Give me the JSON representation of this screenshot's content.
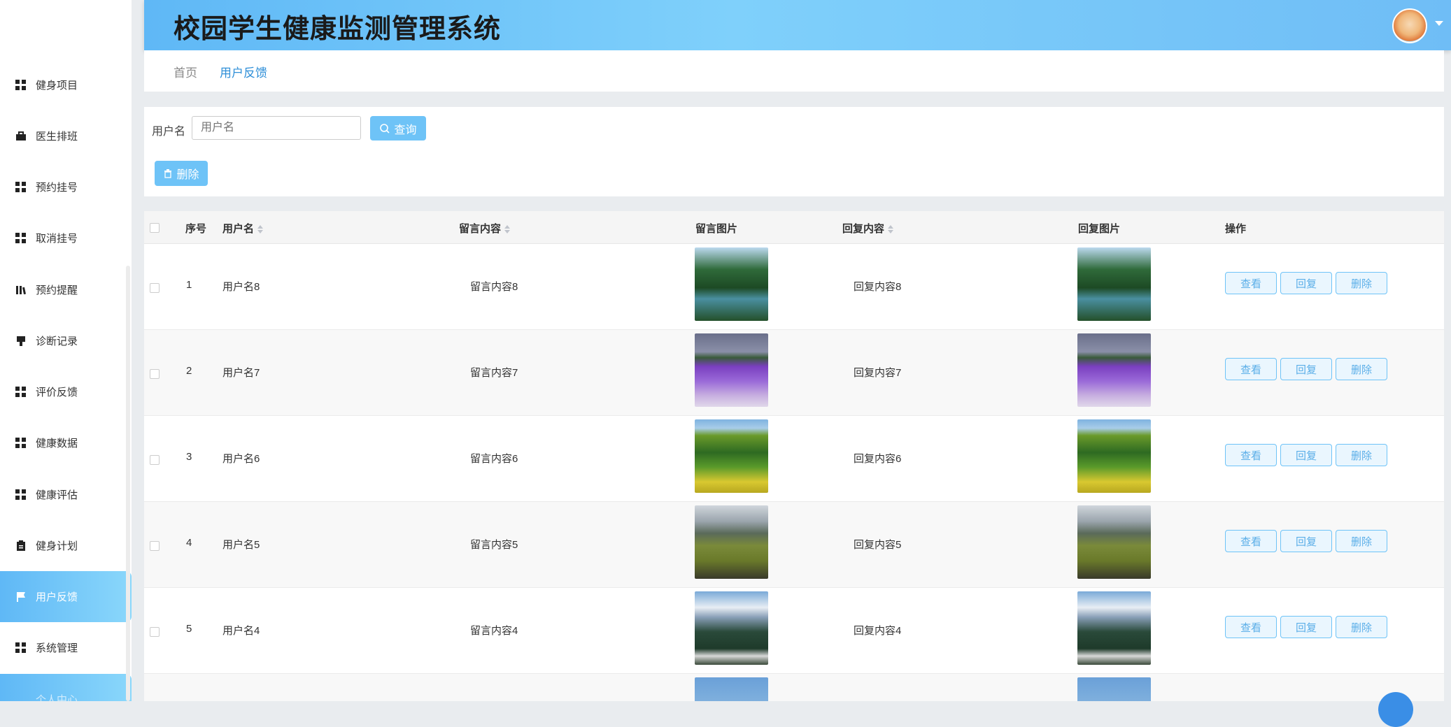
{
  "header": {
    "title": "校园学生健康监测管理系统"
  },
  "sidebar": {
    "items": [
      {
        "label": "健身项目",
        "icon": "grid-icon"
      },
      {
        "label": "医生排班",
        "icon": "briefcase-icon"
      },
      {
        "label": "预约挂号",
        "icon": "grid-icon"
      },
      {
        "label": "取消挂号",
        "icon": "grid-icon"
      },
      {
        "label": "预约提醒",
        "icon": "library-icon"
      },
      {
        "label": "诊断记录",
        "icon": "stamp-icon"
      },
      {
        "label": "评价反馈",
        "icon": "grid-icon"
      },
      {
        "label": "健康数据",
        "icon": "grid-icon"
      },
      {
        "label": "健康评估",
        "icon": "grid-icon"
      },
      {
        "label": "健身计划",
        "icon": "clipboard-icon"
      },
      {
        "label": "用户反馈",
        "icon": "flag-icon"
      },
      {
        "label": "系统管理",
        "icon": "grid-icon"
      },
      {
        "label": "个人中心",
        "icon": "user-icon"
      }
    ],
    "active_label": "用户反馈"
  },
  "breadcrumb": {
    "home": "首页",
    "current": "用户反馈"
  },
  "search": {
    "label": "用户名",
    "placeholder": "用户名",
    "query_button": "查询",
    "delete_button": "删除"
  },
  "table": {
    "headers": {
      "index": "序号",
      "username": "用户名",
      "message": "留言内容",
      "message_image": "留言图片",
      "reply": "回复内容",
      "reply_image": "回复图片",
      "actions": "操作"
    },
    "action_labels": {
      "view": "查看",
      "reply": "回复",
      "delete": "删除"
    },
    "rows": [
      {
        "index": "1",
        "username": "用户名8",
        "message": "留言内容8",
        "reply": "回复内容8",
        "image": "forest-river"
      },
      {
        "index": "2",
        "username": "用户名7",
        "message": "留言内容7",
        "reply": "回复内容7",
        "image": "lavender-field"
      },
      {
        "index": "3",
        "username": "用户名6",
        "message": "留言内容6",
        "reply": "回复内容6",
        "image": "green-hills"
      },
      {
        "index": "4",
        "username": "用户名5",
        "message": "留言内容5",
        "reply": "回复内容5",
        "image": "mountain-valley"
      },
      {
        "index": "5",
        "username": "用户名4",
        "message": "留言内容4",
        "reply": "回复内容4",
        "image": "snow-mountain"
      }
    ]
  },
  "colors": {
    "accent": "#6ec3f7",
    "header_from": "#5fb8f6",
    "header_to": "#7fd0fb"
  }
}
